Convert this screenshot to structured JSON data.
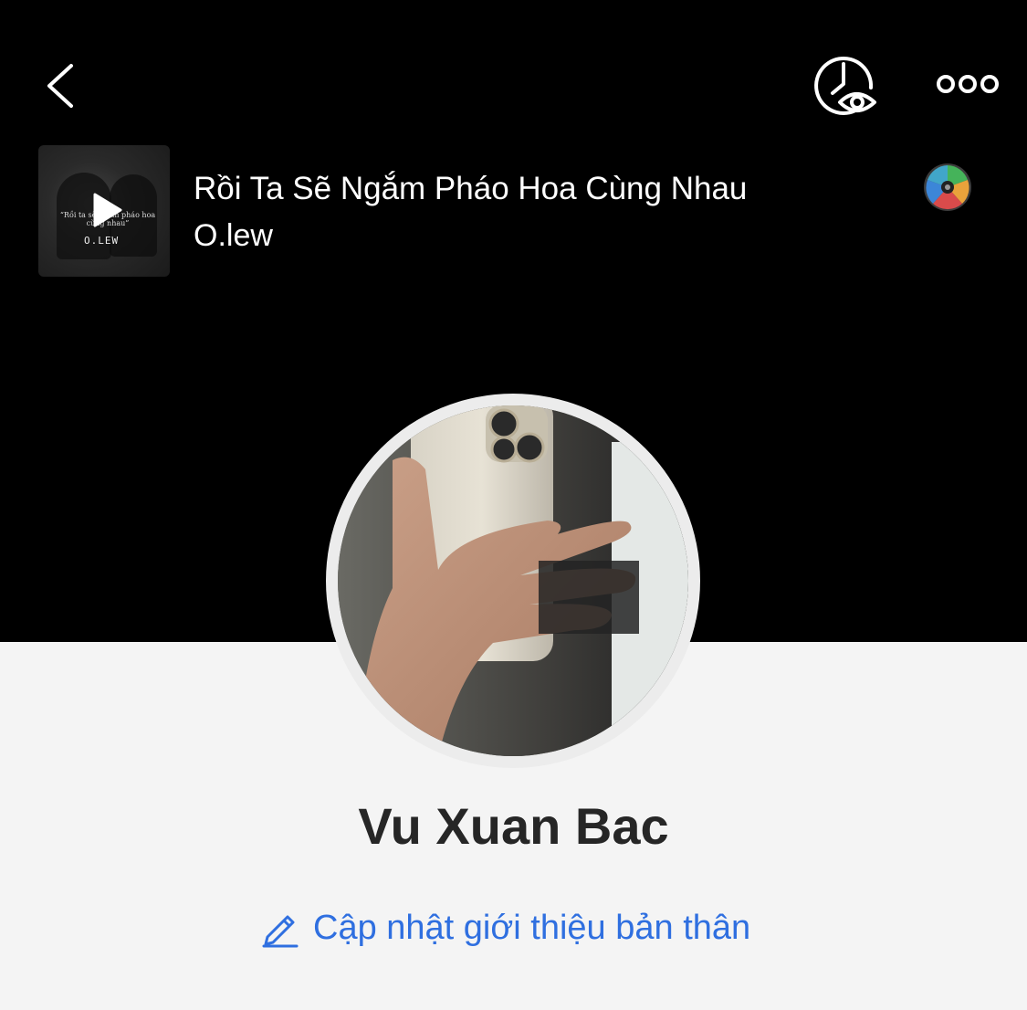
{
  "header": {
    "back_icon": "chevron-left-icon",
    "history_icon": "clock-eye-icon",
    "more_icon": "more-horizontal-icon"
  },
  "music": {
    "title": "Rồi Ta Sẽ Ngắm Pháo Hoa Cùng Nhau",
    "artist": "O.lew",
    "album_quote": "“Rồi ta sẽ ngắm pháo hoa cùng nhau”",
    "album_artist_mark": "O.LEW",
    "play_icon": "play-icon",
    "disc_icon": "music-disc-icon"
  },
  "profile": {
    "name": "Vu Xuan Bac",
    "update_bio_label": "Cập nhật giới thiệu bản thân",
    "update_bio_icon": "pencil-icon"
  },
  "colors": {
    "cover_bg": "#000000",
    "page_bg": "#f4f4f4",
    "link_blue": "#2f6fe0",
    "name_text": "#262626"
  }
}
